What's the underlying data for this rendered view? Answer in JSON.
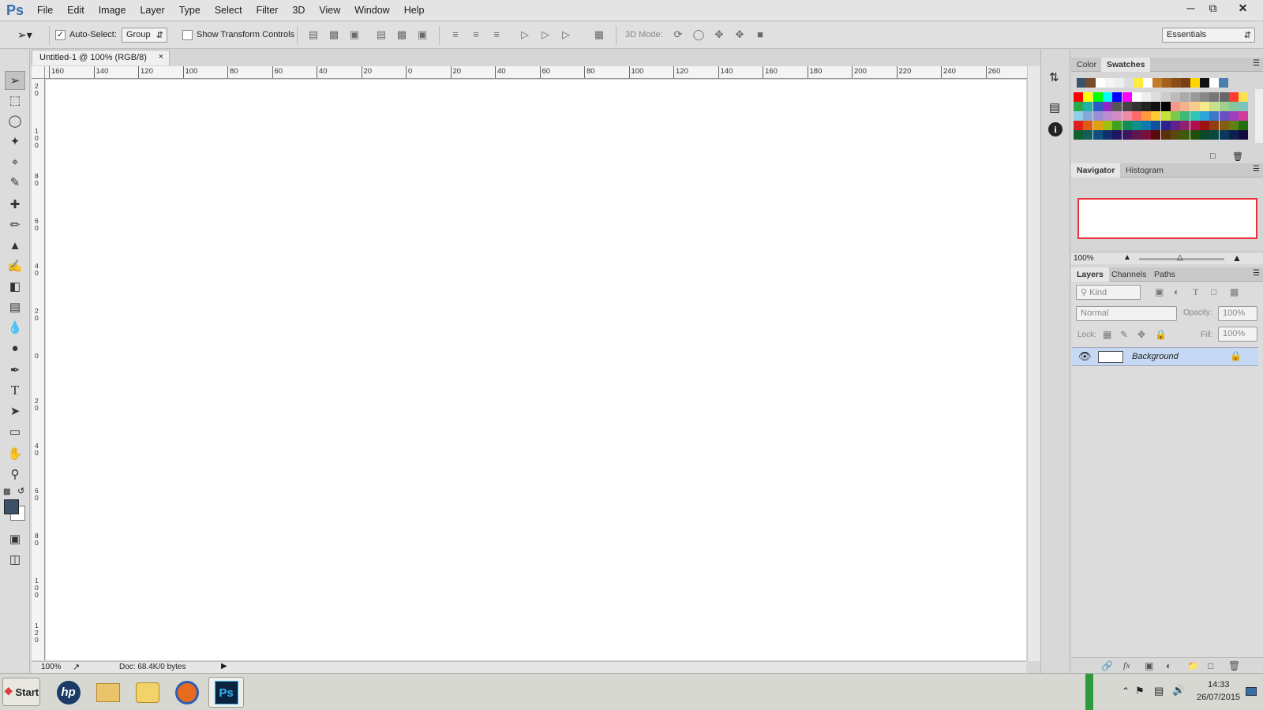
{
  "app": {
    "logo": "Ps",
    "menu": [
      "File",
      "Edit",
      "Image",
      "Layer",
      "Type",
      "Select",
      "Filter",
      "3D",
      "View",
      "Window",
      "Help"
    ],
    "window_controls": {
      "minimize_icon": "minimize-icon",
      "restore_icon": "restore-icon",
      "close_icon": "close-icon"
    }
  },
  "options_bar": {
    "auto_select_label": "Auto-Select:",
    "auto_select_checked": true,
    "auto_select_mode": "Group",
    "show_transform_label": "Show Transform Controls",
    "show_transform_checked": false,
    "mode_3d_label": "3D Mode:",
    "workspace": "Essentials"
  },
  "document": {
    "tab_title": "Untitled-1 @ 100% (RGB/8)",
    "close_glyph": "×",
    "hruler_labels": [
      "160",
      "140",
      "120",
      "100",
      "80",
      "60",
      "40",
      "20",
      "0",
      "20",
      "40",
      "60",
      "80",
      "100",
      "120",
      "140",
      "160",
      "180",
      "200",
      "220",
      "240",
      "260"
    ],
    "vruler_labels": [
      "2\n0",
      "1\n0\n0",
      "8\n0",
      "6\n0",
      "4\n0",
      "2\n0",
      "0",
      "2\n0",
      "4\n0",
      "6\n0",
      "8\n0",
      "1\n0\n0",
      "1\n2\n0"
    ],
    "zoom": "100%",
    "doc_info": "Doc: 68.4K/0 bytes"
  },
  "color_panel": {
    "tabs": [
      "Color",
      "Swatches"
    ],
    "active_tab": "Swatches"
  },
  "navigator_panel": {
    "tabs": [
      "Navigator",
      "Histogram"
    ],
    "active_tab": "Navigator",
    "zoom": "100%",
    "view_box_color": "#e8303a"
  },
  "layers_panel": {
    "tabs": [
      "Layers",
      "Channels",
      "Paths"
    ],
    "active_tab": "Layers",
    "filter_placeholder": "Kind",
    "blend_mode": "Normal",
    "opacity_label": "Opacity:",
    "opacity_value": "100%",
    "lock_label": "Lock:",
    "fill_label": "Fill:",
    "fill_value": "100%",
    "layers": [
      {
        "name": "Background",
        "visible": true,
        "locked": true,
        "selected": true
      }
    ]
  },
  "taskbar": {
    "start_label": "Start",
    "apps": [
      "hp-icon",
      "file-explorer-icon",
      "outlook-icon",
      "firefox-icon",
      "photoshop-icon"
    ],
    "time": "14:33",
    "date": "26/07/2015"
  },
  "colors": {
    "foreground": "#3b5069",
    "background": "#ffffff",
    "layer_highlight": "#c6d9f4",
    "accent_green": "#2e9a3e"
  }
}
